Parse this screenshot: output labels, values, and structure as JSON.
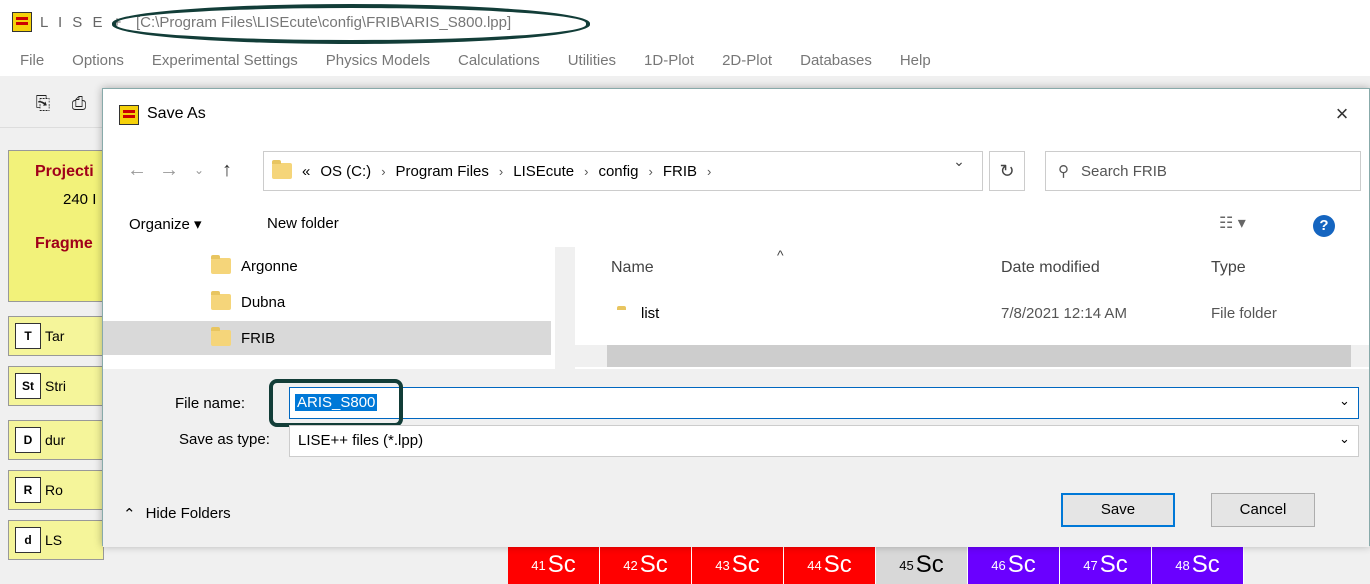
{
  "app": {
    "title_prefix": "L I S E +",
    "path": "[C:\\Program Files\\LISEcute\\config\\FRIB\\ARIS_S800.lpp]"
  },
  "menu": [
    "File",
    "Options",
    "Experimental Settings",
    "Physics Models",
    "Calculations",
    "Utilities",
    "1D-Plot",
    "2D-Plot",
    "Databases",
    "Help"
  ],
  "left_panel": {
    "projectile": "Projecti",
    "value": "240 I",
    "fragment": "Fragme",
    "buttons": [
      {
        "icon": "T",
        "label": "Tar"
      },
      {
        "icon": "St",
        "label": "Stri"
      },
      {
        "icon": "D",
        "label": "dur"
      },
      {
        "icon": "R",
        "label": "Ro"
      },
      {
        "icon": "d",
        "label": "LS"
      }
    ]
  },
  "elements": [
    {
      "mass": "41",
      "symbol": "Sc",
      "color": "#ff0000"
    },
    {
      "mass": "42",
      "symbol": "Sc",
      "color": "#ff0000"
    },
    {
      "mass": "43",
      "symbol": "Sc",
      "color": "#ff0000"
    },
    {
      "mass": "44",
      "symbol": "Sc",
      "color": "#ff0000"
    },
    {
      "mass": "45",
      "symbol": "Sc",
      "color": "#d8d8d8"
    },
    {
      "mass": "46",
      "symbol": "Sc",
      "color": "#6a00ff"
    },
    {
      "mass": "47",
      "symbol": "Sc",
      "color": "#6a00ff"
    },
    {
      "mass": "48",
      "symbol": "Sc",
      "color": "#6a00ff"
    }
  ],
  "dialog": {
    "title": "Save As",
    "close": "×",
    "address": {
      "prefix": "«",
      "crumbs": [
        "OS (C:)",
        "Program Files",
        "LISEcute",
        "config",
        "FRIB"
      ]
    },
    "search_placeholder": "Search FRIB",
    "organize": "Organize ▾",
    "new_folder": "New folder",
    "tree": [
      "Argonne",
      "Dubna",
      "FRIB"
    ],
    "columns": {
      "name": "Name",
      "date": "Date modified",
      "type": "Type"
    },
    "rows": [
      {
        "name": "list",
        "date": "7/8/2021 12:14 AM",
        "type": "File folder"
      }
    ],
    "file_name_label": "File name:",
    "file_name_value": "ARIS_S800",
    "save_type_label": "Save as type:",
    "save_type_value": "LISE++ files (*.lpp)",
    "hide_folders": "Hide Folders",
    "save": "Save",
    "cancel": "Cancel"
  }
}
